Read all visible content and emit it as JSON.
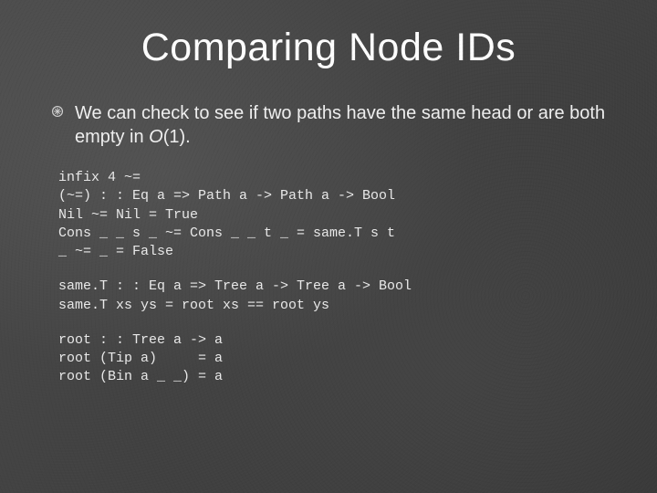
{
  "title": "Comparing Node IDs",
  "bullet": {
    "prefix": "We can check to see if two paths have the same head or are both empty in ",
    "complexity": "O",
    "suffix": "(1)."
  },
  "code": {
    "block1": "infix 4 ~=\n(~=) : : Eq a => Path a -> Path a -> Bool\nNil ~= Nil = True\nCons _ _ s _ ~= Cons _ _ t _ = same.T s t\n_ ~= _ = False",
    "block2": "same.T : : Eq a => Tree a -> Tree a -> Bool\nsame.T xs ys = root xs == root ys",
    "block3": "root : : Tree a -> a\nroot (Tip a)     = a\nroot (Bin a _ _) = a"
  }
}
